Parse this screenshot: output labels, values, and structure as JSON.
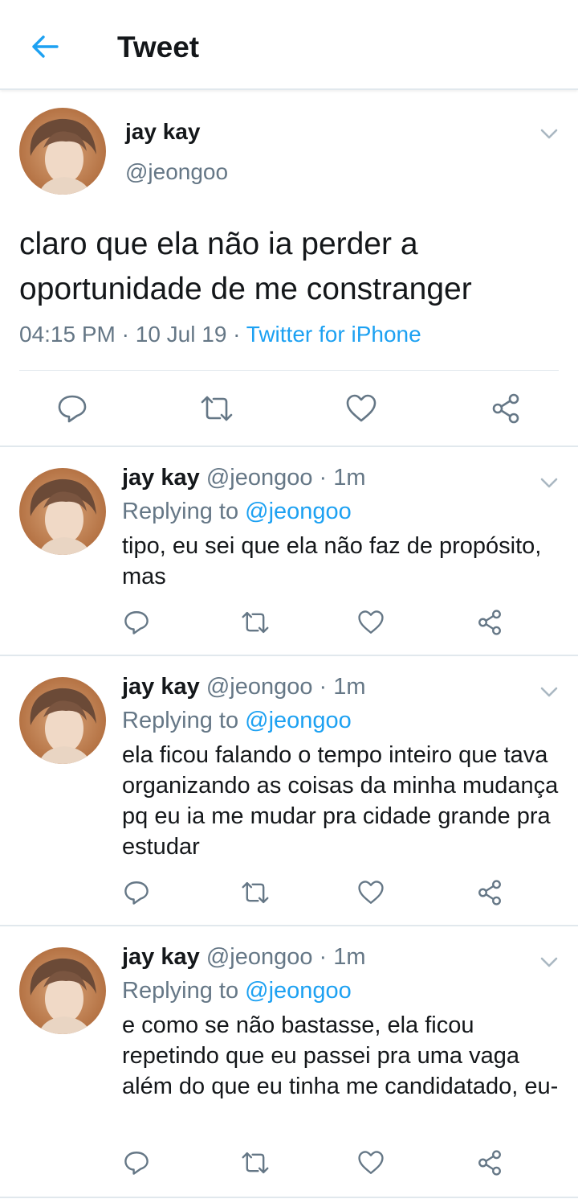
{
  "header": {
    "title": "Tweet",
    "back_icon": "arrow-left-icon"
  },
  "colors": {
    "accent": "#1da1f2",
    "secondary_text": "#657786",
    "divider": "#e1e8ed"
  },
  "main_tweet": {
    "name": "jay kay",
    "handle": "@jeongoo",
    "text": "claro que ela não ia perder a oportunidade de me constranger",
    "time": "04:15 PM",
    "date": "10 Jul 19",
    "source": "Twitter for iPhone"
  },
  "replies": [
    {
      "name": "jay kay",
      "handle": "@jeongoo",
      "time": "1m",
      "replying_prefix": "Replying to",
      "replying_to": "@jeongoo",
      "text": "tipo, eu sei que ela não faz de propósito, mas"
    },
    {
      "name": "jay kay",
      "handle": "@jeongoo",
      "time": "1m",
      "replying_prefix": "Replying to",
      "replying_to": "@jeongoo",
      "text": "ela ficou falando o tempo inteiro que tava organizando as coisas da minha mudança pq eu ia me mudar pra cidade grande pra estudar"
    },
    {
      "name": "jay kay",
      "handle": "@jeongoo",
      "time": "1m",
      "replying_prefix": "Replying to",
      "replying_to": "@jeongoo",
      "text": "e como se não bastasse, ela ficou repetindo que eu passei pra uma vaga além do que eu tinha me candidatado, eu-"
    }
  ]
}
